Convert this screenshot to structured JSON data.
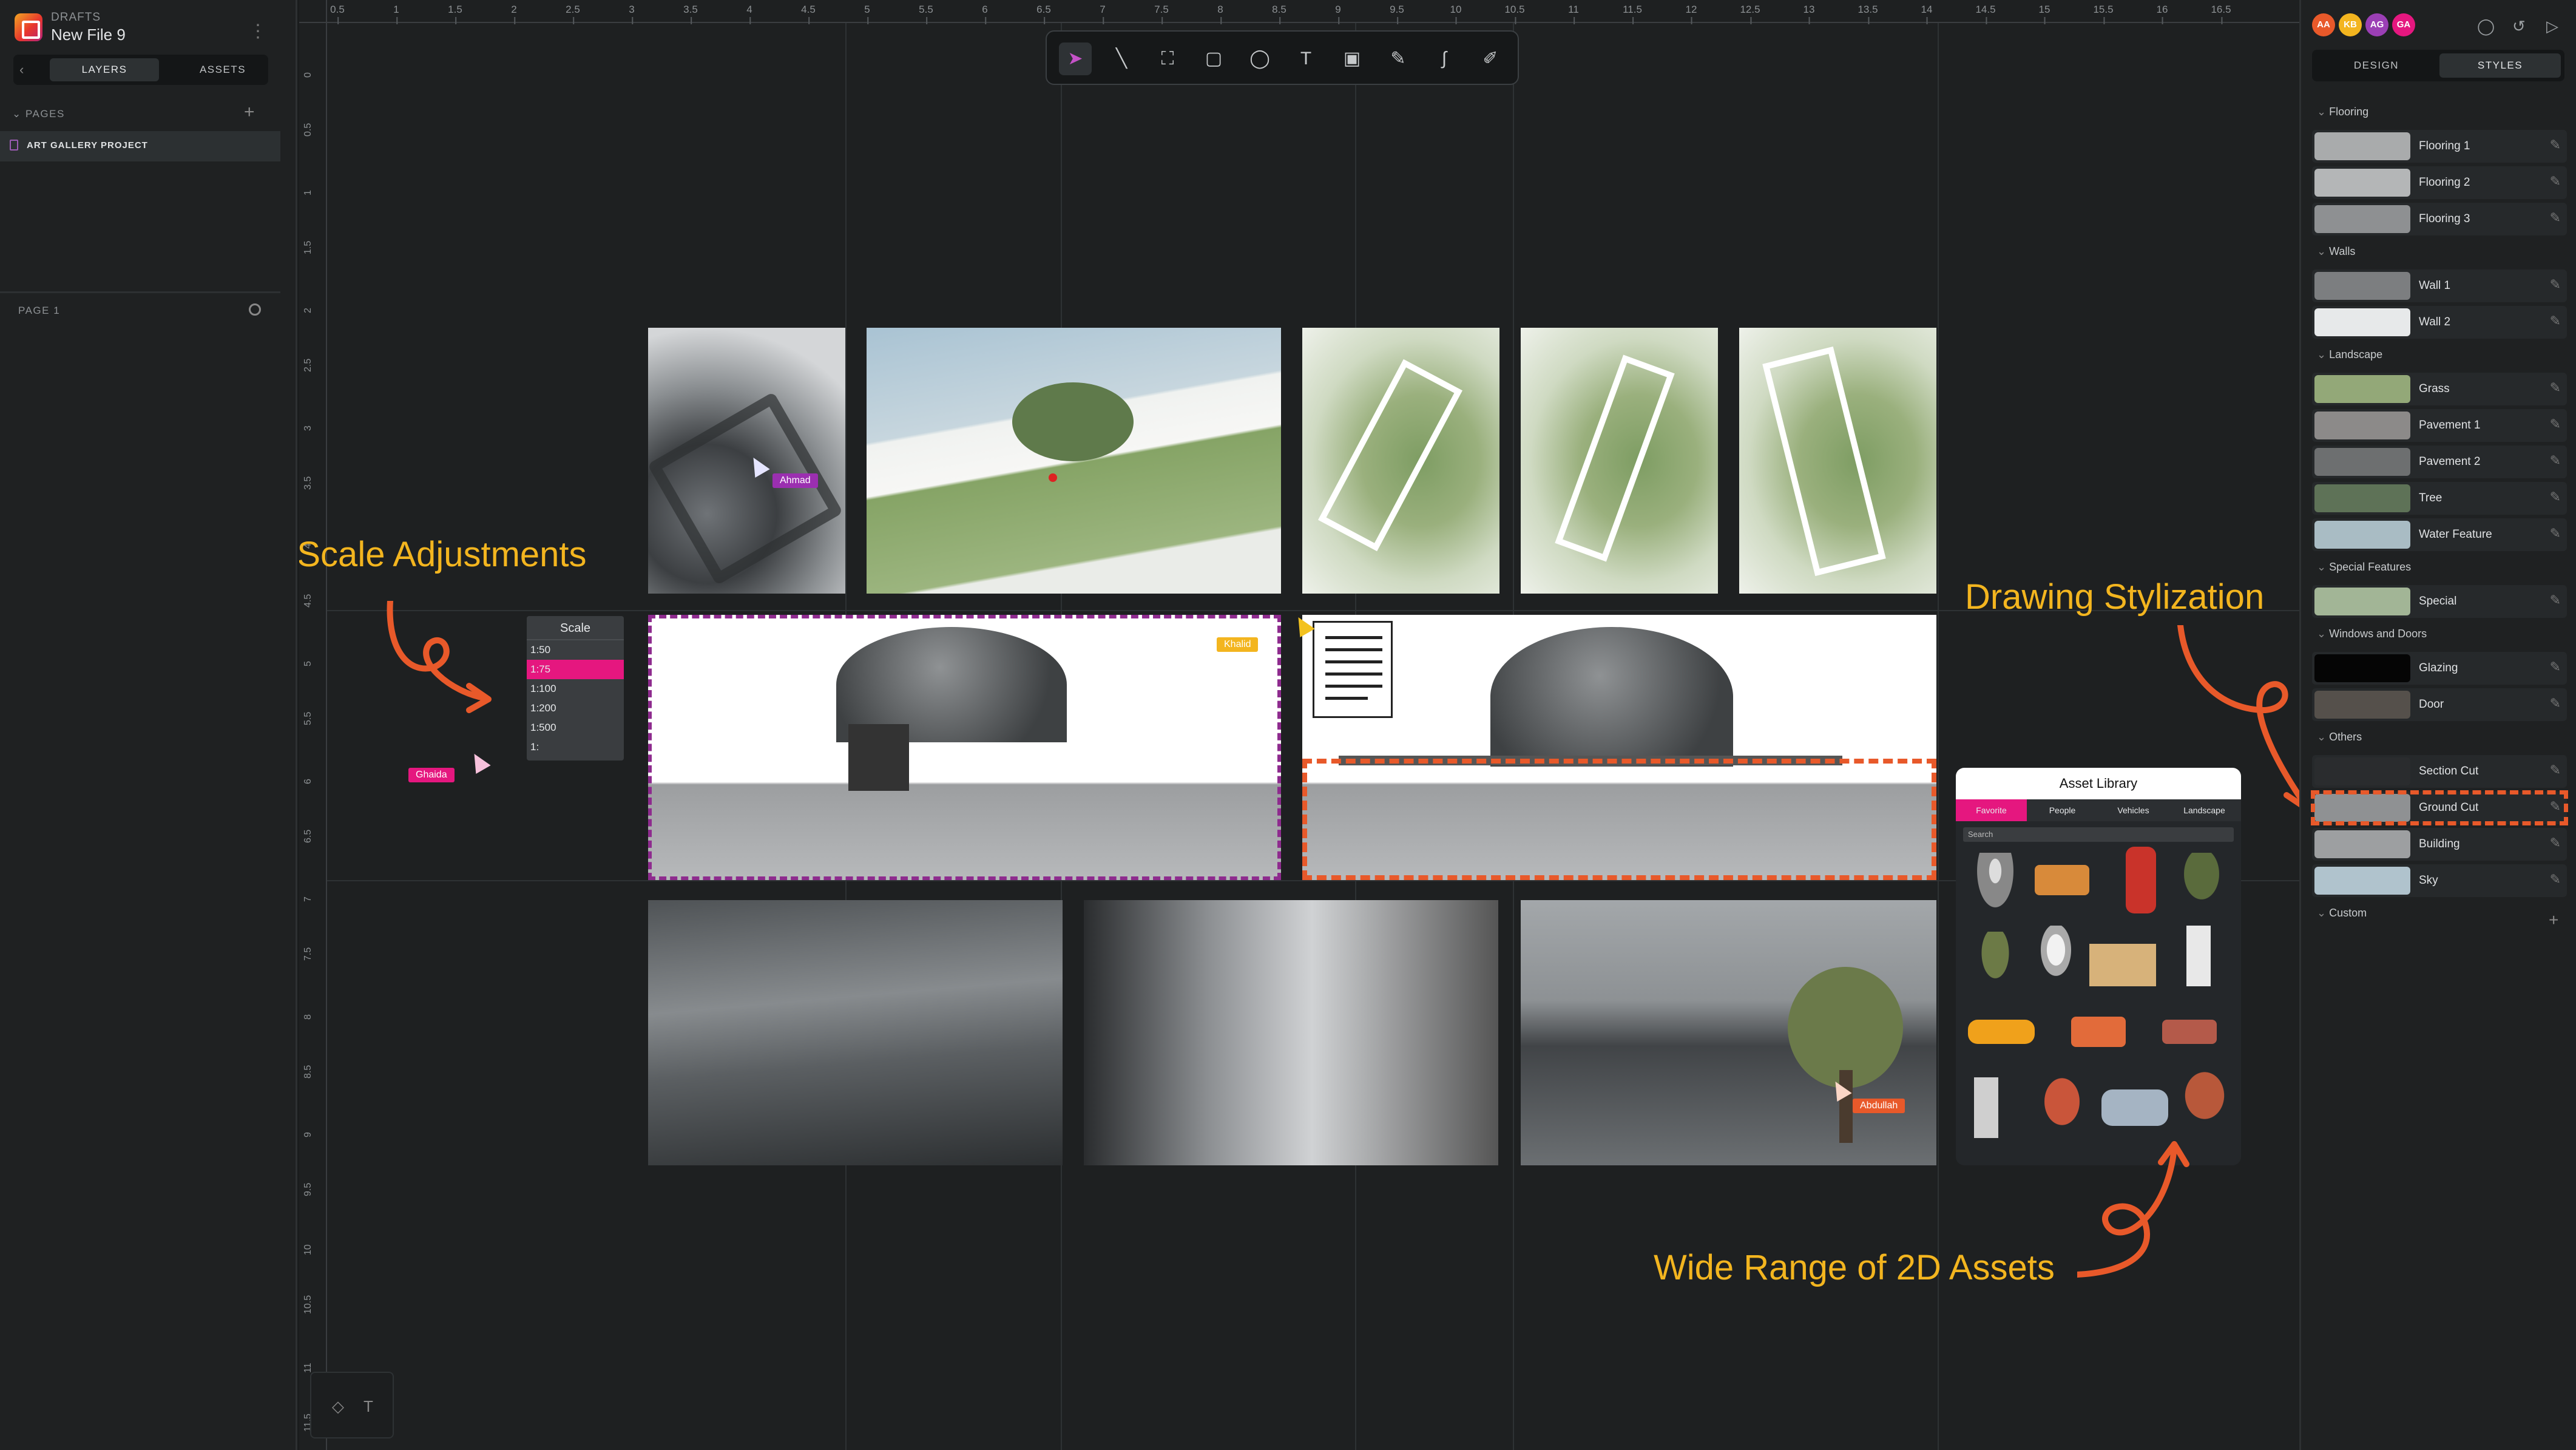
{
  "left": {
    "crumb": "DRAFTS",
    "file_name": "New File 9",
    "tabs": [
      "LAYERS",
      "ASSETS"
    ],
    "pages_header": "PAGES",
    "page_item": "ART GALLERY PROJECT",
    "layers_header": "PAGE 1"
  },
  "ruler": {
    "top": [
      "0.5",
      "1",
      "1.5",
      "2",
      "2.5",
      "3",
      "3.5",
      "4",
      "4.5",
      "5",
      "5.5",
      "6",
      "6.5",
      "7",
      "7.5",
      "8",
      "8.5",
      "9",
      "9.5",
      "10",
      "10.5",
      "11",
      "11.5",
      "12",
      "12.5",
      "13",
      "13.5",
      "14",
      "14.5",
      "15",
      "15.5",
      "16",
      "16.5"
    ],
    "left": [
      "0",
      "0.5",
      "1",
      "1.5",
      "2",
      "2.5",
      "3",
      "3.5",
      "4",
      "4.5",
      "5",
      "5.5",
      "6",
      "6.5",
      "7",
      "7.5",
      "8",
      "8.5",
      "9",
      "9.5",
      "10",
      "10.5",
      "11",
      "11.5"
    ]
  },
  "toolbar": {
    "tools": [
      {
        "name": "select-tool",
        "glyph": "➤"
      },
      {
        "name": "line-tool",
        "glyph": "╲"
      },
      {
        "name": "frame-tool",
        "glyph": "⛶"
      },
      {
        "name": "rectangle-tool",
        "glyph": "▢"
      },
      {
        "name": "ellipse-tool",
        "glyph": "◯"
      },
      {
        "name": "text-tool",
        "glyph": "T"
      },
      {
        "name": "image-tool",
        "glyph": "▣"
      },
      {
        "name": "pencil-tool",
        "glyph": "✎"
      },
      {
        "name": "path-tool",
        "glyph": "∫"
      },
      {
        "name": "brush-tool",
        "glyph": "✐"
      }
    ]
  },
  "scale": {
    "title": "Scale",
    "options": [
      "1:50",
      "1:75",
      "1:100",
      "1:200",
      "1:500",
      "1:"
    ],
    "selected": "1:75"
  },
  "collaborators": {
    "ahmad": "Ahmad",
    "khalid": "Khalid",
    "ghaida": "Ghaida",
    "abdullah": "Abdullah"
  },
  "asset_library": {
    "title": "Asset Library",
    "tabs": [
      "Favorite",
      "People",
      "Vehicles",
      "Landscape"
    ],
    "selected_tab": "Favorite",
    "search_placeholder": "Search"
  },
  "annotations": {
    "scale": "Quick Scale Adjustments",
    "stylization": "Drawing Stylization",
    "assets": "Wide Range of 2D Assets"
  },
  "right": {
    "avatars": [
      {
        "initials": "AA",
        "color": "#e8592a"
      },
      {
        "initials": "KB",
        "color": "#f3b51f"
      },
      {
        "initials": "AG",
        "color": "#9b3fb5"
      },
      {
        "initials": "GA",
        "color": "#e5177f"
      }
    ],
    "tabs": [
      "DESIGN",
      "STYLES"
    ],
    "active_tab": "STYLES",
    "groups": [
      {
        "label": "Flooring",
        "items": [
          {
            "name": "Flooring 1",
            "swatch": "#a9abac"
          },
          {
            "name": "Flooring 2",
            "swatch": "#b4b6b7"
          },
          {
            "name": "Flooring 3",
            "swatch": "#8e9092"
          }
        ]
      },
      {
        "label": "Walls",
        "items": [
          {
            "name": "Wall 1",
            "swatch": "#7c7e80"
          },
          {
            "name": "Wall 2",
            "swatch": "#e7e9ea"
          }
        ]
      },
      {
        "label": "Landscape",
        "items": [
          {
            "name": "Grass",
            "swatch": "#93a878"
          },
          {
            "name": "Pavement 1",
            "swatch": "#8c8a89"
          },
          {
            "name": "Pavement 2",
            "swatch": "#6d6f70"
          },
          {
            "name": "Tree",
            "swatch": "#5e7257"
          },
          {
            "name": "Water Feature",
            "swatch": "#a9bcc4"
          }
        ]
      },
      {
        "label": "Special Features",
        "items": [
          {
            "name": "Special",
            "swatch": "#a2b596"
          }
        ]
      },
      {
        "label": "Windows and Doors",
        "items": [
          {
            "name": "Glazing",
            "swatch": "#050505"
          },
          {
            "name": "Door",
            "swatch": "#55504b"
          }
        ]
      },
      {
        "label": "Others",
        "items": [
          {
            "name": "Section Cut",
            "swatch": "#2a2c2e"
          },
          {
            "name": "Ground Cut",
            "swatch": "#8f9193"
          },
          {
            "name": "Building",
            "swatch": "#9d9fa1"
          },
          {
            "name": "Sky",
            "swatch": "#b0c3cd"
          }
        ]
      },
      {
        "label": "Custom",
        "items": []
      }
    ]
  }
}
